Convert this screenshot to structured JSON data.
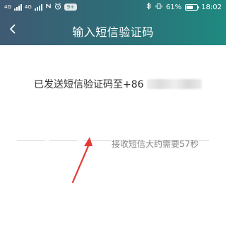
{
  "status_bar": {
    "left_labels": [
      "4G",
      "4G"
    ],
    "alarm_icon": "alarm-icon",
    "notification_badge": "9+",
    "battery_percent": "61%",
    "battery_level": 0.61,
    "time": "18:02"
  },
  "header": {
    "title": "输入短信验证码",
    "back_icon": "chevron-left-icon"
  },
  "main": {
    "sent_prefix": "已发送短信验证码至+86",
    "code_slots": [
      "",
      "",
      "",
      "",
      "",
      ""
    ],
    "wait_text": "接收短信大约需要57秒"
  },
  "colors": {
    "header_start": "#3f5a73",
    "header_end": "#1f8a80",
    "arrow": "#e53935"
  }
}
